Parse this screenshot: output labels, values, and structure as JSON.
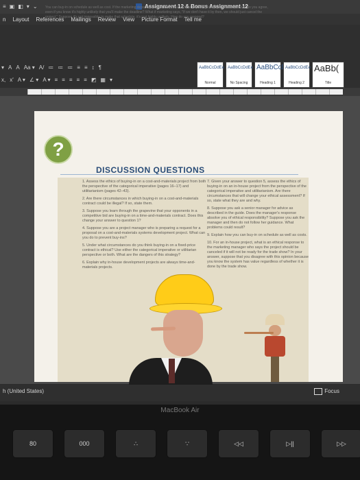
{
  "window": {
    "title": "Assignment 12 & Bonus Assignment 12",
    "quick_access": [
      "≡",
      "▣",
      "◧",
      "▾",
      "⌄"
    ]
  },
  "ribbon": {
    "tabs": [
      "n",
      "Layout",
      "References",
      "Mailings",
      "Review",
      "View",
      "Picture Format",
      "Tell me"
    ],
    "tools_row1": [
      "▾",
      "A",
      "A",
      "Aa ▾",
      "A/",
      "≔",
      "≔",
      "≔",
      "≡",
      "≡",
      "↕",
      "¶"
    ],
    "tools_row2": [
      "x,",
      "x'",
      "A ▾",
      "∠ ▾",
      "A ▾",
      "≡",
      "≡",
      "≡",
      "≡",
      "≡",
      "◩",
      "▦",
      "▾"
    ],
    "styles": [
      {
        "sample": "AaBbCcDdEe",
        "name": "Normal"
      },
      {
        "sample": "AaBbCcDdEe",
        "name": "No Spacing"
      },
      {
        "sample": "AaBbCcDc",
        "name": "Heading 1"
      },
      {
        "sample": "AaBbCcDdEe",
        "name": "Heading 2"
      },
      {
        "sample": "AaBb(",
        "name": "Title"
      }
    ]
  },
  "document": {
    "intro": "You can buy-in on schedule as well as cost. If the marketing department says, \"We have to have the new product for the trade show\" do you agree, even if you know it's highly unlikely that you'll make the deadline? What if marketing says, \"If we don't have it by then, we should just cancel the project.\" Suppose it's not impossible to make that schedule; it's just highly unlikely. How do you respond?",
    "badge": "?",
    "section_title": "DISCUSSION QUESTIONS",
    "questions_left": [
      "1. Assess the ethics of buying-in on a cost-and-materials project from both the perspective of the categorical imperative (pages 16–17) and utilitarianism (pages 42–43).",
      "2. Are there circumstances in which buying-in on a cost-and-materials contract could be illegal? If so, state them.",
      "3. Suppose you learn through the grapevine that your opponents in a competitive bid are buying-in on a time-and-materials contract. Does this change your answer to question 1?",
      "4. Suppose you are a project manager who is preparing a request for a proposal on a cost-and-materials systems development project. What can you do to prevent buy-ins?",
      "5. Under what circumstances do you think buying-in on a fixed-price contract is ethical? Use either the categorical imperative or utilitarian perspective or both. What are the dangers of this strategy?",
      "6. Explain why in-house development projects are always time-and-materials projects."
    ],
    "questions_right": [
      "7. Given your answer to question 5, assess the ethics of buying-in on an in-house project from the perspective of the categorical imperative and utilitarianism. Are there circumstances that will change your ethical assessment? If so, state what they are and why.",
      "8. Suppose you ask a senior manager for advice as described in the guide. Does the manager's response absolve you of ethical responsibility? Suppose you ask the manager and then do not follow her guidance. What problems could result?",
      "9. Explain how you can buy-in on schedule as well as costs.",
      "10. For an in-house project, what is an ethical response to the marketing manager who says the project should be canceled if it will not be ready for the trade show? In your answer, suppose that you disagree with this opinion because you know the system has value regardless of whether it is done by the trade show."
    ]
  },
  "statusbar": {
    "language": "h (United States)",
    "focus": "Focus"
  },
  "keyboard": {
    "brand": "MacBook Air",
    "keys": [
      "80",
      "000",
      "∴",
      "∵",
      "◁◁",
      "▷||",
      "▷▷"
    ]
  },
  "colors": {
    "badge": "#7fa044",
    "title": "#294c77",
    "panel": "#e4ddc8"
  }
}
